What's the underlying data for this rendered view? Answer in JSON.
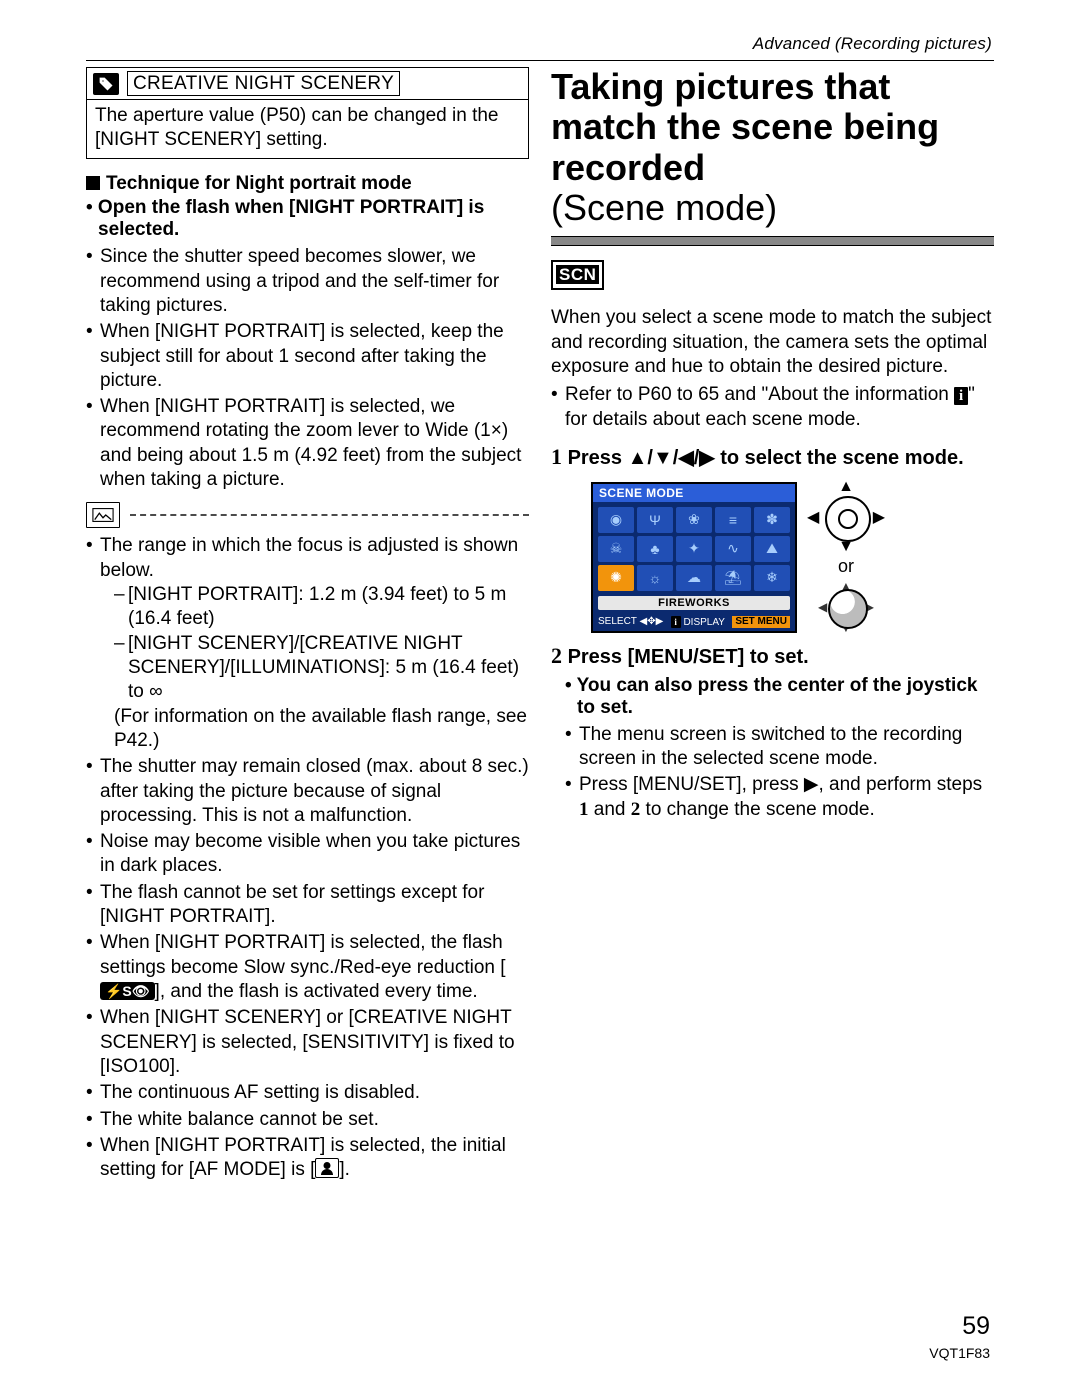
{
  "header": "Advanced (Recording pictures)",
  "left": {
    "box_label": "CREATIVE NIGHT SCENERY",
    "box_body": "The aperture value (P50) can be changed in the [NIGHT SCENERY] setting.",
    "sec_title": "Technique for Night portrait mode",
    "tip1": "• Open the flash when [NIGHT PORTRAIT] is selected.",
    "bullets1": [
      "Since the shutter speed becomes slower, we recommend using a tripod and the self-timer for taking pictures.",
      "When [NIGHT PORTRAIT] is selected, keep the subject still for about 1 second after taking the picture.",
      "When [NIGHT PORTRAIT] is selected, we recommend rotating the zoom lever to Wide (1×) and being about 1.5 m (4.92 feet) from the subject when taking a picture."
    ],
    "range_lead": "The range in which the focus is adjusted is shown below.",
    "range_items": [
      "[NIGHT PORTRAIT]:  1.2 m (3.94 feet) to 5 m (16.4 feet)",
      "[NIGHT SCENERY]/[CREATIVE NIGHT SCENERY]/[ILLUMINATIONS]:  5 m (16.4 feet) to ∞"
    ],
    "range_paren": "(For information on the available flash range, see P42.)",
    "bullets2a": [
      "The shutter may remain closed (max. about 8 sec.) after taking the picture because of signal processing. This is not a malfunction.",
      "Noise may become visible when you take pictures in dark places.",
      "The flash cannot be set for settings except for [NIGHT PORTRAIT]."
    ],
    "flash_line_pre": "When [NIGHT PORTRAIT] is selected, the flash settings become Slow sync./Red-eye reduction [",
    "flash_chip": "⚡S👁",
    "flash_line_post": "], and the flash is activated every time.",
    "bullets2b": [
      "When [NIGHT SCENERY] or [CREATIVE NIGHT SCENERY] is selected, [SENSITIVITY] is fixed to [ISO100].",
      "The continuous AF setting is disabled.",
      "The white balance cannot be set."
    ],
    "afmode_pre": "When [NIGHT PORTRAIT] is selected, the initial setting for [AF MODE] is [",
    "afmode_post": "]."
  },
  "right": {
    "h1_main": "Taking pictures that match the scene being recorded",
    "h1_sub": "(Scene mode)",
    "scn_label": "SCN",
    "intro": "When you select a scene mode to match the subject and recording situation, the camera sets the optimal exposure and hue to obtain the desired picture.",
    "refer_pre": "Refer to P60 to 65 and \"About the information ",
    "refer_post": "\" for details about each scene mode.",
    "step1_pre": "Press ",
    "step1_arrows": "▲/▼/◀/▶",
    "step1_post": " to select the scene mode.",
    "lcd": {
      "title": "SCENE MODE",
      "selected_label": "FIREWORKS",
      "foot_left": "SELECT ◀✥▶",
      "foot_info": "i",
      "foot_disp": "DISPLAY",
      "foot_set": "SET MENU"
    },
    "or": "or",
    "step2": "Press [MENU/SET] to set.",
    "tip2": "• You can also press the center of the joystick to set.",
    "bullets3": [
      "The menu screen is switched to the recording screen in the selected scene mode."
    ],
    "press_change_pre": "Press [MENU/SET], press ▶, and perform steps ",
    "press_change_mid": " and ",
    "press_change_post": " to change the scene mode.",
    "num1": "1",
    "num2": "2"
  },
  "page_number": "59",
  "doc_code": "VQT1F83"
}
